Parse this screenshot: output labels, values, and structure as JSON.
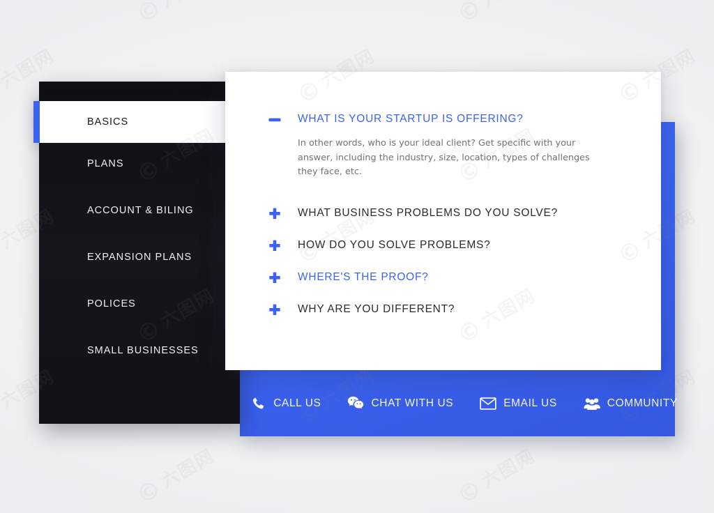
{
  "colors": {
    "accent_blue": "#3b63f0",
    "card_white": "#ffffff",
    "sidebar_dark": "#111317",
    "page_background": "#f5f5f5",
    "question_text": "#2b2b2b",
    "answer_text": "#6f7277"
  },
  "sidebar": {
    "items": [
      {
        "label": "BASICS",
        "active": true
      },
      {
        "label": "PLANS",
        "active": false
      },
      {
        "label": "ACCOUNT & BILING",
        "active": false
      },
      {
        "label": "EXPANSION PLANS",
        "active": false
      },
      {
        "label": "POLICES",
        "active": false
      },
      {
        "label": "SMALL BUSINESSES",
        "active": false
      }
    ]
  },
  "faq": {
    "items": [
      {
        "question": "WHAT IS YOUR STARTUP IS OFFERING?",
        "toggle_icon": "minus-icon",
        "state": "open",
        "answer": "In other words, who is your ideal client? Get specific with your answer, including the industry, size, location, types of challenges they face, etc."
      },
      {
        "question": "WHAT BUSINESS PROBLEMS DO YOU SOLVE?",
        "toggle_icon": "plus-icon",
        "state": "collapsed",
        "answer": ""
      },
      {
        "question": "HOW DO YOU SOLVE PROBLEMS?",
        "toggle_icon": "plus-icon",
        "state": "collapsed",
        "answer": ""
      },
      {
        "question": "WHERE'S THE PROOF?",
        "toggle_icon": "plus-icon",
        "state": "highlight",
        "answer": ""
      },
      {
        "question": "WHY ARE YOU DIFFERENT?",
        "toggle_icon": "plus-icon",
        "state": "collapsed",
        "answer": ""
      }
    ]
  },
  "contact_bar": {
    "items": [
      {
        "label": "CALL US",
        "icon": "phone-icon"
      },
      {
        "label": "CHAT WITH US",
        "icon": "wechat-chat-icon"
      },
      {
        "label": "EMAIL US",
        "icon": "envelope-icon"
      },
      {
        "label": "COMMUNITY",
        "icon": "people-group-icon"
      }
    ]
  },
  "watermark": {
    "text": "六图网",
    "mark": "©"
  }
}
